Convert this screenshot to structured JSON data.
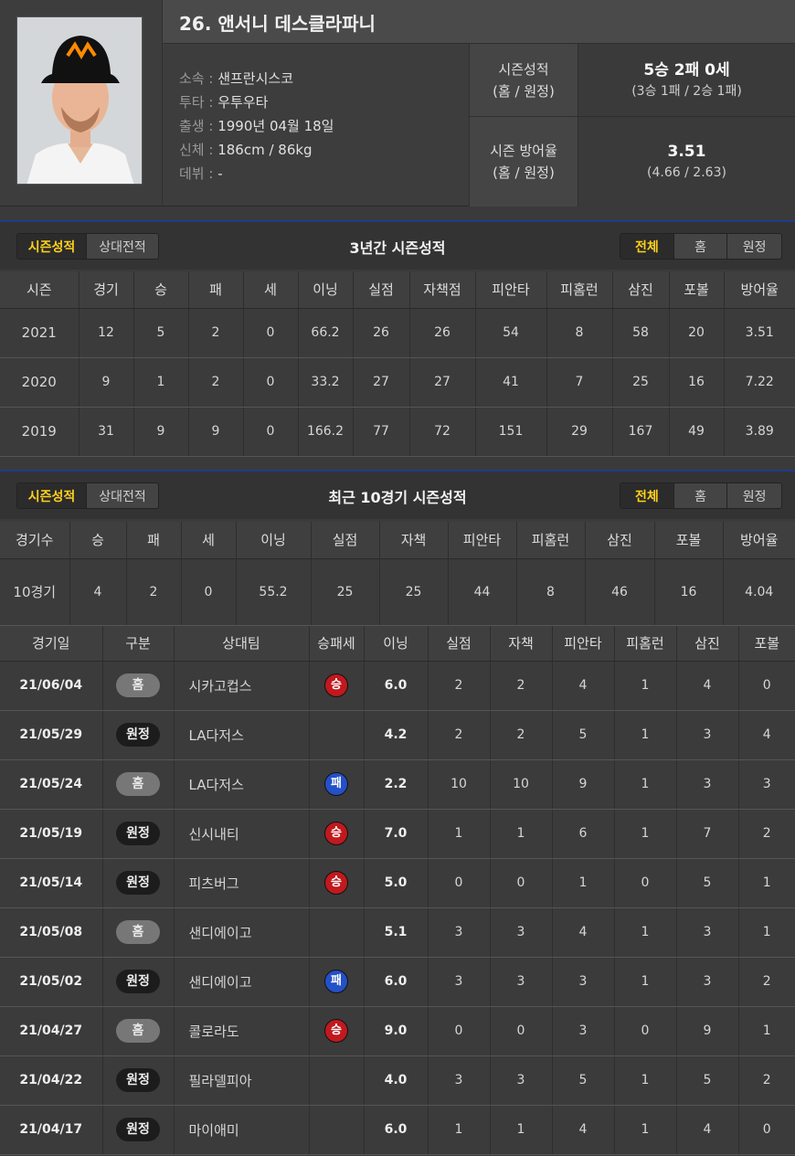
{
  "player": {
    "name": "26. 앤서니 데스클라파니",
    "info": [
      {
        "k": "소속 : ",
        "v": "샌프란시스코"
      },
      {
        "k": "투타 : ",
        "v": "우투우타"
      },
      {
        "k": "출생 : ",
        "v": "1990년 04월 18일"
      },
      {
        "k": "신체 : ",
        "v": "186cm / 86kg"
      },
      {
        "k": "데뷔 : ",
        "v": "-"
      }
    ],
    "record_label": "시즌성적",
    "record_sub": "(홈 / 원정)",
    "record_value": "5승 2패 0세",
    "record_split": "(3승 1패 / 2승 1패)",
    "era_label": "시즌 방어율",
    "era_sub": "(홈 / 원정)",
    "era_value": "3.51",
    "era_split": "(4.66 / 2.63)"
  },
  "toggle": {
    "season": "시즌성적",
    "opponent": "상대전적",
    "all": "전체",
    "home": "홈",
    "away": "원정"
  },
  "season_table": {
    "title": "3년간 시즌성적",
    "headers": [
      "시즌",
      "경기",
      "승",
      "패",
      "세",
      "이닝",
      "실점",
      "자책점",
      "피안타",
      "피홈런",
      "삼진",
      "포볼",
      "방어율"
    ],
    "rows": [
      [
        "2021",
        "12",
        "5",
        "2",
        "0",
        "66.2",
        "26",
        "26",
        "54",
        "8",
        "58",
        "20",
        "3.51"
      ],
      [
        "2020",
        "9",
        "1",
        "2",
        "0",
        "33.2",
        "27",
        "27",
        "41",
        "7",
        "25",
        "16",
        "7.22"
      ],
      [
        "2019",
        "31",
        "9",
        "9",
        "0",
        "166.2",
        "77",
        "72",
        "151",
        "29",
        "167",
        "49",
        "3.89"
      ]
    ]
  },
  "recent_table": {
    "title": "최근 10경기 시즌성적",
    "headers": [
      "경기수",
      "승",
      "패",
      "세",
      "이닝",
      "실점",
      "자책",
      "피안타",
      "피홈런",
      "삼진",
      "포볼",
      "방어율"
    ],
    "row": [
      "10경기",
      "4",
      "2",
      "0",
      "55.2",
      "25",
      "25",
      "44",
      "8",
      "46",
      "16",
      "4.04"
    ]
  },
  "games_table": {
    "headers": [
      "경기일",
      "구분",
      "상대팀",
      "승패세",
      "이닝",
      "실점",
      "자책",
      "피안타",
      "피홈런",
      "삼진",
      "포볼"
    ],
    "rows": [
      {
        "date": "21/06/04",
        "type": "홈",
        "opp": "시카고컵스",
        "res": "승",
        "ip": "6.0",
        "r": "2",
        "er": "2",
        "h": "4",
        "hr": "1",
        "so": "4",
        "bb": "0"
      },
      {
        "date": "21/05/29",
        "type": "원정",
        "opp": "LA다저스",
        "res": "",
        "ip": "4.2",
        "r": "2",
        "er": "2",
        "h": "5",
        "hr": "1",
        "so": "3",
        "bb": "4"
      },
      {
        "date": "21/05/24",
        "type": "홈",
        "opp": "LA다저스",
        "res": "패",
        "ip": "2.2",
        "r": "10",
        "er": "10",
        "h": "9",
        "hr": "1",
        "so": "3",
        "bb": "3"
      },
      {
        "date": "21/05/19",
        "type": "원정",
        "opp": "신시내티",
        "res": "승",
        "ip": "7.0",
        "r": "1",
        "er": "1",
        "h": "6",
        "hr": "1",
        "so": "7",
        "bb": "2"
      },
      {
        "date": "21/05/14",
        "type": "원정",
        "opp": "피츠버그",
        "res": "승",
        "ip": "5.0",
        "r": "0",
        "er": "0",
        "h": "1",
        "hr": "0",
        "so": "5",
        "bb": "1"
      },
      {
        "date": "21/05/08",
        "type": "홈",
        "opp": "샌디에이고",
        "res": "",
        "ip": "5.1",
        "r": "3",
        "er": "3",
        "h": "4",
        "hr": "1",
        "so": "3",
        "bb": "1"
      },
      {
        "date": "21/05/02",
        "type": "원정",
        "opp": "샌디에이고",
        "res": "패",
        "ip": "6.0",
        "r": "3",
        "er": "3",
        "h": "3",
        "hr": "1",
        "so": "3",
        "bb": "2"
      },
      {
        "date": "21/04/27",
        "type": "홈",
        "opp": "콜로라도",
        "res": "승",
        "ip": "9.0",
        "r": "0",
        "er": "0",
        "h": "3",
        "hr": "0",
        "so": "9",
        "bb": "1"
      },
      {
        "date": "21/04/22",
        "type": "원정",
        "opp": "필라델피아",
        "res": "",
        "ip": "4.0",
        "r": "3",
        "er": "3",
        "h": "5",
        "hr": "1",
        "so": "5",
        "bb": "2"
      },
      {
        "date": "21/04/17",
        "type": "원정",
        "opp": "마이애미",
        "res": "",
        "ip": "6.0",
        "r": "1",
        "er": "1",
        "h": "4",
        "hr": "1",
        "so": "4",
        "bb": "0"
      }
    ]
  }
}
